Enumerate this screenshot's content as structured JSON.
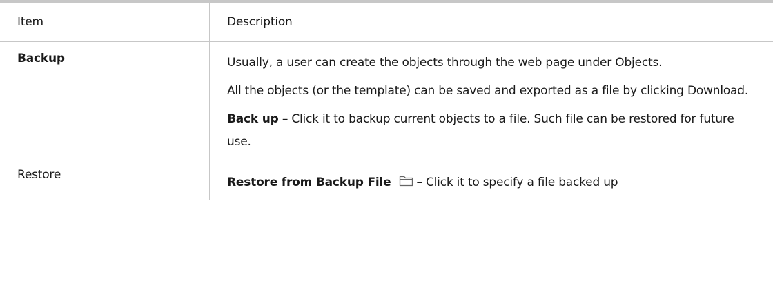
{
  "table": {
    "headers": {
      "item": "Item",
      "description": "Description"
    },
    "rows": [
      {
        "item": "Backup",
        "paragraphs": [
          {
            "text": "Usually, a user can create the objects through the web page under Objects."
          },
          {
            "text": "All the objects (or the template) can be saved and exported as a file by clicking Download."
          },
          {
            "bold": "Back up",
            "text": " – Click it to backup current objects to a file. Such file can be restored for future use."
          }
        ]
      },
      {
        "item": "Restore",
        "paragraphs": [
          {
            "bold": "Restore from Backup File",
            "icon": "folder-icon",
            "text": "– Click it to specify a file backed up"
          }
        ]
      }
    ]
  },
  "colors": {
    "border": "#c7c7c7",
    "text": "#1a1a1a",
    "icon_stroke": "#666666"
  }
}
